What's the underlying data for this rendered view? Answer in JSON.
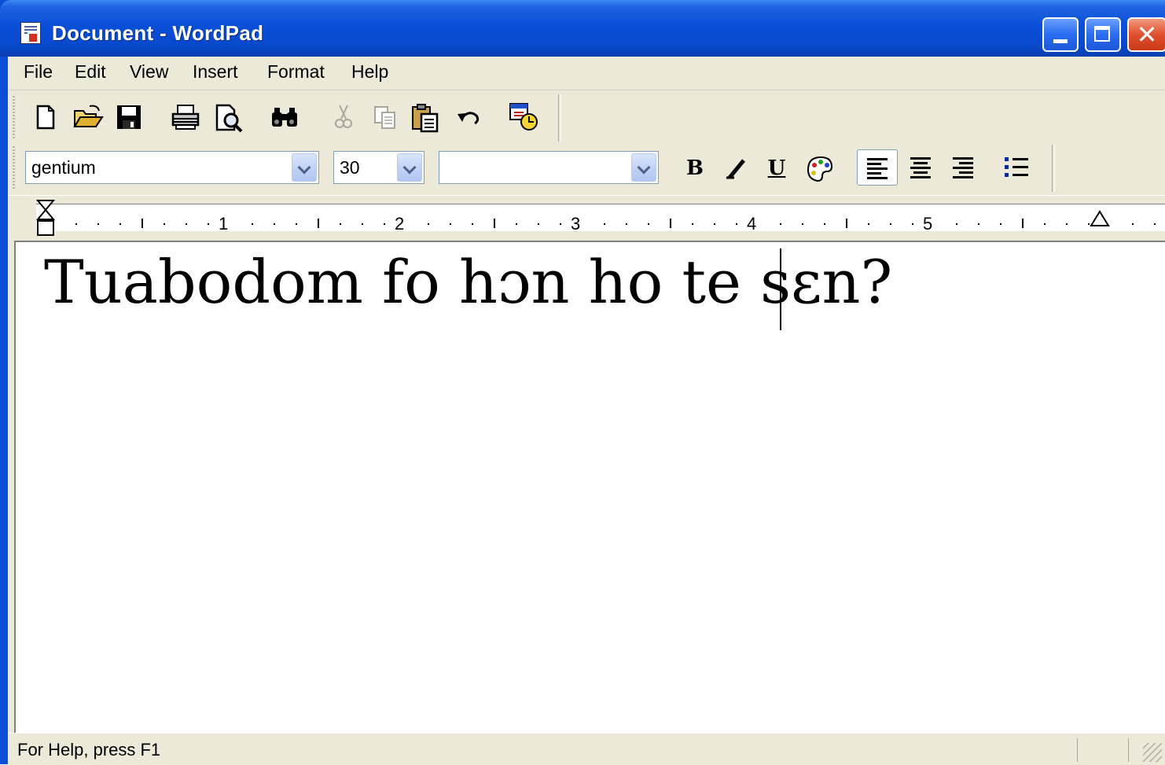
{
  "window": {
    "title": "Document - WordPad"
  },
  "menu": {
    "items": [
      "File",
      "Edit",
      "View",
      "Insert",
      "Format",
      "Help"
    ]
  },
  "toolbar": {
    "icons": [
      "new-document-icon",
      "open-folder-icon",
      "save-icon",
      "print-icon",
      "print-preview-icon",
      "find-icon",
      "cut-icon",
      "copy-icon",
      "paste-icon",
      "undo-icon",
      "date-time-icon"
    ]
  },
  "format_bar": {
    "font_name": "gentium",
    "font_size": "30",
    "script": "",
    "bold_label": "B",
    "italic_label": "/",
    "underline_label": "U"
  },
  "ruler": {
    "numbers": [
      "1",
      "2",
      "3",
      "4",
      "5"
    ]
  },
  "document": {
    "text": "Tuabodom fo hɔn ho te sɛn?"
  },
  "status": {
    "help_text": "For Help, press F1"
  }
}
